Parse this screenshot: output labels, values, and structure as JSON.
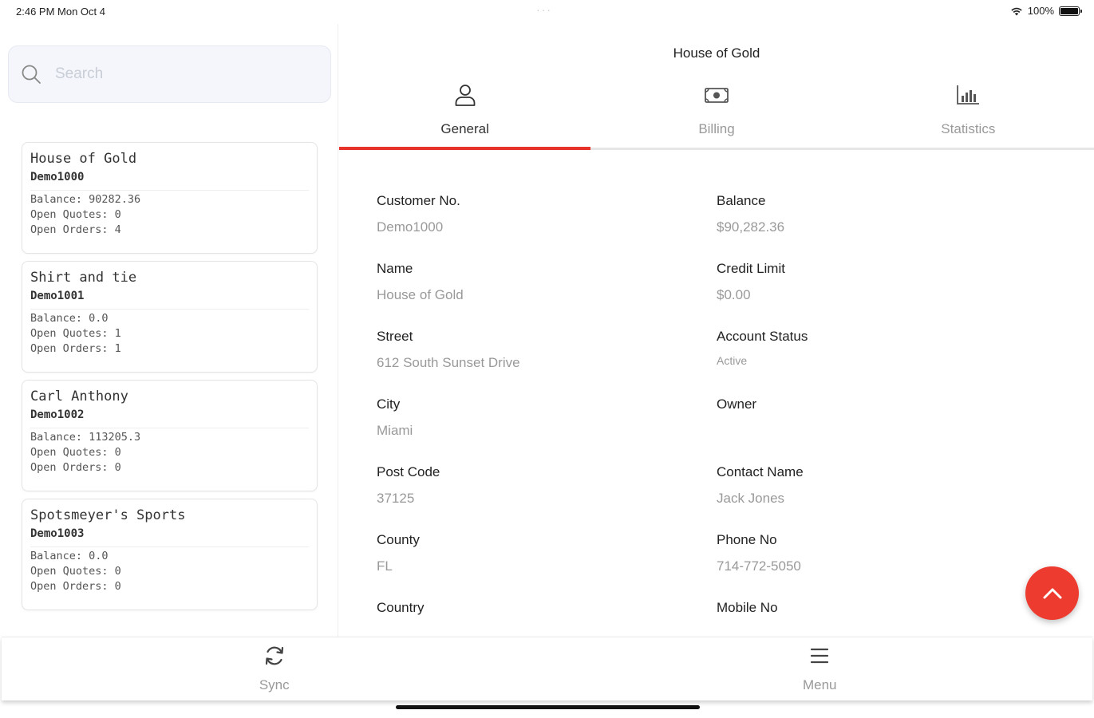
{
  "status_bar": {
    "time": "2:46 PM   Mon Oct 4",
    "dots": "···",
    "battery_text": "100%"
  },
  "search": {
    "placeholder": "Search",
    "value": ""
  },
  "customers": [
    {
      "name": "House of Gold",
      "id": "Demo1000",
      "balance": "Balance: 90282.36",
      "quotes": "Open Quotes: 0",
      "orders": "Open Orders: 4"
    },
    {
      "name": "Shirt and tie",
      "id": "Demo1001",
      "balance": "Balance: 0.0",
      "quotes": "Open Quotes: 1",
      "orders": "Open Orders: 1"
    },
    {
      "name": "Carl Anthony",
      "id": "Demo1002",
      "balance": "Balance: 113205.3",
      "quotes": "Open Quotes: 0",
      "orders": "Open Orders: 0"
    },
    {
      "name": "Spotsmeyer's Sports",
      "id": "Demo1003",
      "balance": "Balance: 0.0",
      "quotes": "Open Quotes: 0",
      "orders": "Open Orders: 0"
    }
  ],
  "detail": {
    "title": "House of Gold",
    "tabs": [
      {
        "label": "General",
        "icon": "user-icon",
        "active": true
      },
      {
        "label": "Billing",
        "icon": "money-icon",
        "active": false
      },
      {
        "label": "Statistics",
        "icon": "bar-chart-icon",
        "active": false
      }
    ],
    "fields": {
      "customer_no": {
        "label": "Customer No.",
        "value": "Demo1000"
      },
      "balance": {
        "label": "Balance",
        "value": "$90,282.36"
      },
      "name": {
        "label": "Name",
        "value": "House of Gold"
      },
      "credit_limit": {
        "label": "Credit Limit",
        "value": "$0.00"
      },
      "street": {
        "label": "Street",
        "value": "612 South Sunset Drive"
      },
      "account_status": {
        "label": "Account Status",
        "value": "Active"
      },
      "city": {
        "label": "City",
        "value": "Miami"
      },
      "owner": {
        "label": "Owner",
        "value": ""
      },
      "post_code": {
        "label": "Post Code",
        "value": "37125"
      },
      "contact_name": {
        "label": "Contact Name",
        "value": "Jack Jones"
      },
      "county": {
        "label": "County",
        "value": "FL"
      },
      "phone_no": {
        "label": "Phone No",
        "value": "714-772-5050"
      },
      "country": {
        "label": "Country",
        "value": ""
      },
      "mobile_no": {
        "label": "Mobile No",
        "value": ""
      }
    }
  },
  "fab_icon": "chevron-up-icon",
  "bottom_bar": {
    "sync_label": "Sync",
    "menu_label": "Menu"
  },
  "colors": {
    "accent": "#e8332a",
    "fab": "#ee3b2f"
  }
}
